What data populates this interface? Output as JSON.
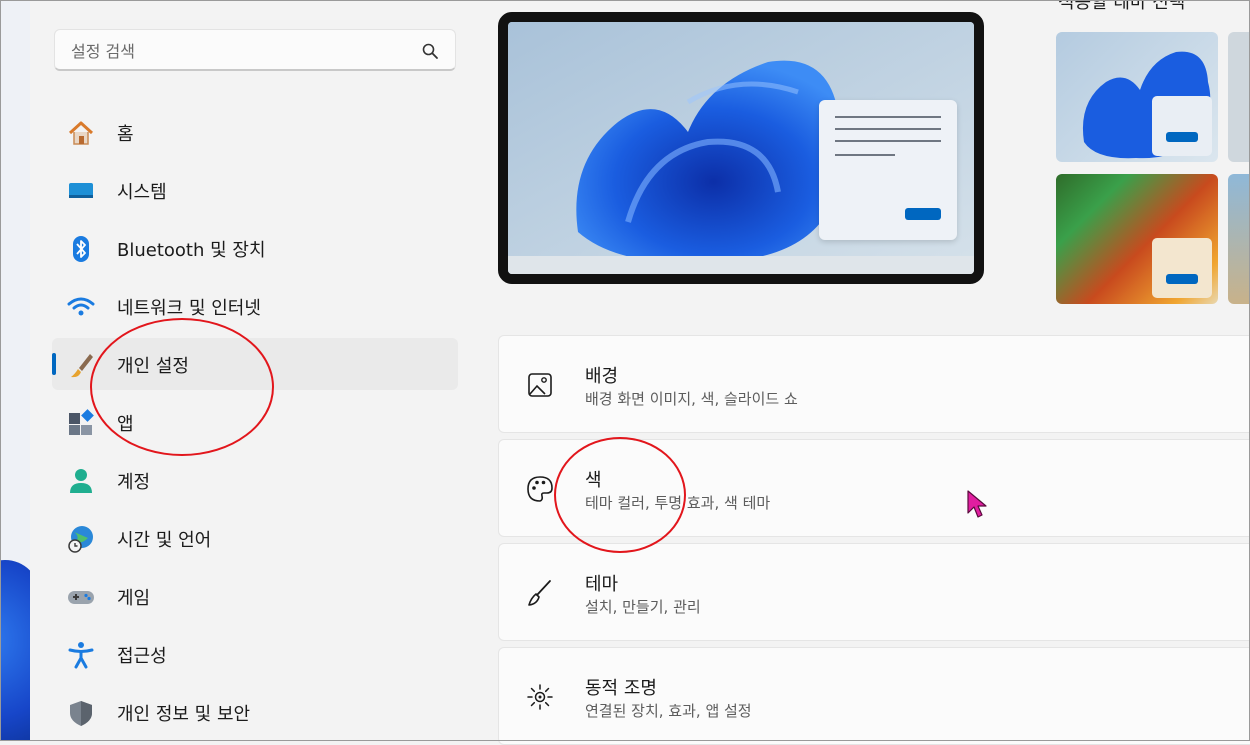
{
  "search": {
    "placeholder": "설정 검색",
    "icon": "search-icon"
  },
  "sidebar": {
    "items": [
      {
        "label": "홈",
        "icon": "home-icon"
      },
      {
        "label": "시스템",
        "icon": "system-icon"
      },
      {
        "label": "Bluetooth 및 장치",
        "icon": "bluetooth-icon"
      },
      {
        "label": "네트워크 및 인터넷",
        "icon": "wifi-icon"
      },
      {
        "label": "개인 설정",
        "icon": "brush-icon",
        "selected": true
      },
      {
        "label": "앱",
        "icon": "apps-icon"
      },
      {
        "label": "계정",
        "icon": "account-icon"
      },
      {
        "label": "시간 및 언어",
        "icon": "globe-clock-icon"
      },
      {
        "label": "게임",
        "icon": "gamepad-icon"
      },
      {
        "label": "접근성",
        "icon": "accessibility-icon"
      },
      {
        "label": "개인 정보 및 보안",
        "icon": "shield-icon"
      }
    ]
  },
  "main": {
    "themes_title": "적용할 테마 선택",
    "cards": [
      {
        "title": "배경",
        "subtitle": "배경 화면 이미지, 색, 슬라이드 쇼",
        "icon": "image-icon"
      },
      {
        "title": "색",
        "subtitle": "테마 컬러, 투명 효과, 색 테마",
        "icon": "palette-icon"
      },
      {
        "title": "테마",
        "subtitle": "설치, 만들기, 관리",
        "icon": "brush-icon"
      },
      {
        "title": "동적 조명",
        "subtitle": "연결된 장치, 효과, 앱 설정",
        "icon": "sun-icon"
      }
    ]
  },
  "colors": {
    "accent": "#0067c0",
    "annotation": "#e2161c",
    "cursor": "#e11ea0"
  }
}
